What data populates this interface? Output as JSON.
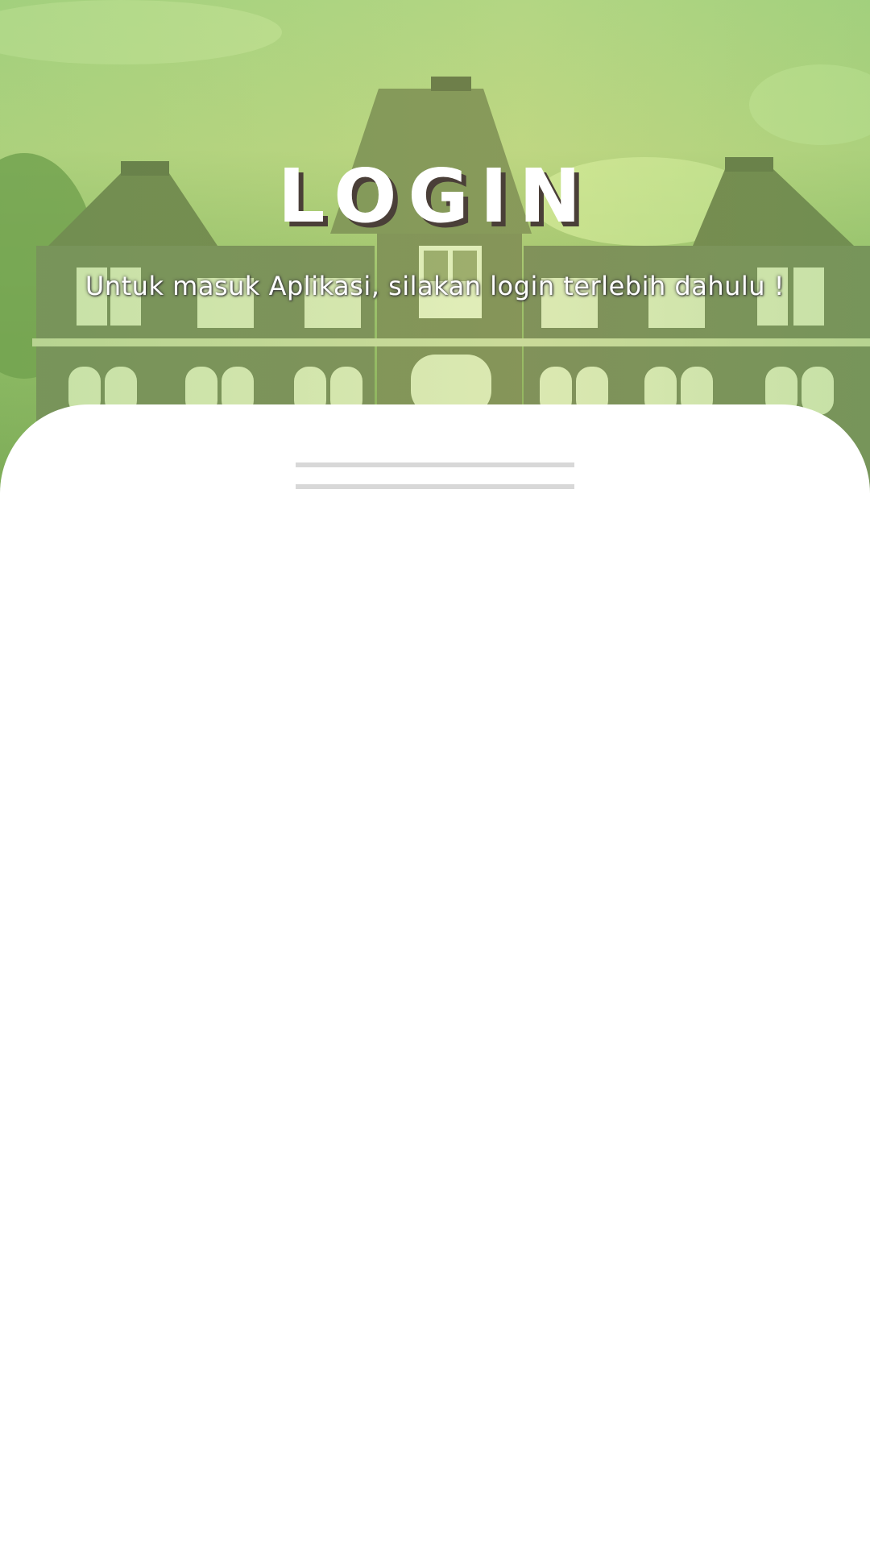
{
  "header": {
    "title": "LOGIN",
    "subtitle": "Untuk masuk Aplikasi, silakan login terlebih dahulu !"
  },
  "colors": {
    "overlay_green": "#a9cf80",
    "sheet": "#ffffff",
    "handle": "#d8d8d8",
    "title_shadow": "#4a3f38"
  }
}
